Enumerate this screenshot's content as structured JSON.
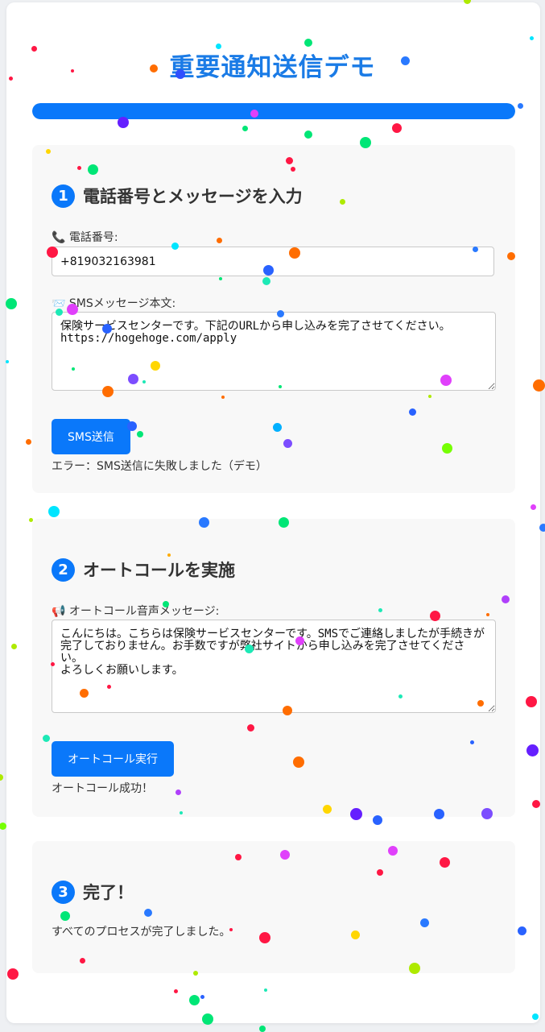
{
  "page": {
    "title": "重要通知送信デモ"
  },
  "progress": {
    "percent": 100,
    "color": "#0a78fa"
  },
  "step1": {
    "number": "1",
    "title": "電話番号とメッセージを入力",
    "phone_label": "📞 電話番号:",
    "phone_value": "+819032163981",
    "sms_label": "📨 SMSメッセージ本文:",
    "sms_text": "保険サービスセンターです。下記のURLから申し込みを完了させてください。\nhttps://hogehoge.com/apply",
    "send_button": "SMS送信",
    "status": "エラー：SMS送信に失敗しました（デモ）"
  },
  "step2": {
    "number": "2",
    "title": "オートコールを実施",
    "voice_label": "📢 オートコール音声メッセージ:",
    "voice_text": "こんにちは。こちらは保険サービスセンターです。SMSでご連絡しましたが手続きが完了しておりません。お手数ですが弊社サイトから申し込みを完了させてください。\nよろしくお願いします。",
    "call_button": "オートコール実行",
    "status": "オートコール成功！"
  },
  "step3": {
    "number": "3",
    "title": "完了！",
    "message": "すべてのプロセスが完了しました。"
  },
  "colors": {
    "accent": "#0a78fa",
    "title": "#1a7be6"
  }
}
